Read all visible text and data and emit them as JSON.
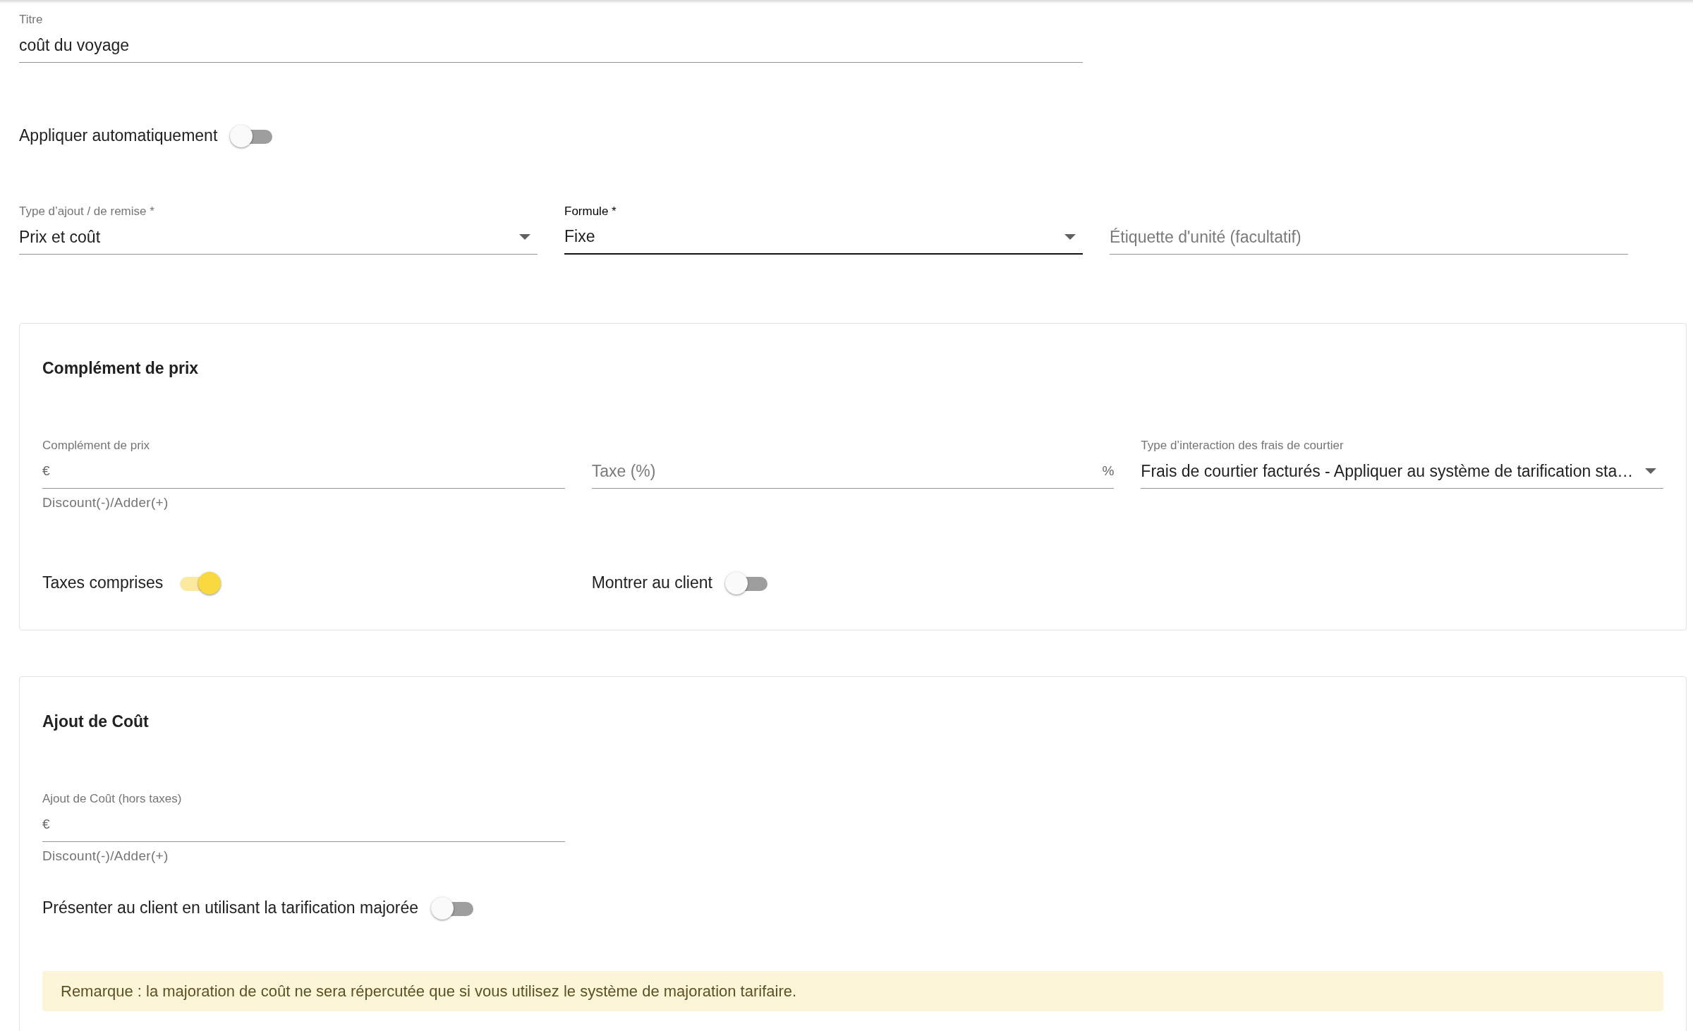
{
  "title_field": {
    "label": "Titre",
    "value": "coût du voyage",
    "focused": false
  },
  "auto_apply": {
    "label": "Appliquer automatiquement",
    "on": false
  },
  "fields": [
    {
      "kind": "select",
      "label": "Type d’ajout / de remise *",
      "value": "Prix et coût",
      "focused": false
    },
    {
      "kind": "select",
      "label": "Formule *",
      "value": "Fixe",
      "focused": true
    },
    {
      "kind": "text",
      "placeholder": "Étiquette d'unité (facultatif)",
      "focused": false
    }
  ],
  "sections": [
    {
      "title": "Complément de prix",
      "fields": [
        {
          "kind": "text",
          "label": "Complément de prix",
          "prefix": "€",
          "helper": "Discount(-)/Adder(+)",
          "focused": false
        },
        {
          "kind": "text",
          "placeholder": "Taxe (%)",
          "suffix": "%",
          "focused": false
        },
        {
          "kind": "select",
          "label": "Type d’interaction des frais de courtier",
          "value": "Frais de courtier facturés - Appliquer au système de tarification sta…",
          "focused": false
        }
      ],
      "toggles": [
        {
          "label": "Taxes comprises",
          "on": true
        },
        {
          "label": "Montrer au client",
          "on": false
        }
      ]
    },
    {
      "title": "Ajout de Coût",
      "fields": [
        {
          "kind": "text",
          "label": "Ajout de Coût (hors taxes)",
          "prefix": "€",
          "helper": "Discount(-)/Adder(+)",
          "focused": false
        }
      ],
      "toggles": [
        {
          "label": "Présenter au client en utilisant la tarification majorée",
          "on": false
        }
      ],
      "note": "Remarque : la majoration de coût ne sera répercutée que si vous utilisez le système de majoration tarifaire."
    }
  ]
}
